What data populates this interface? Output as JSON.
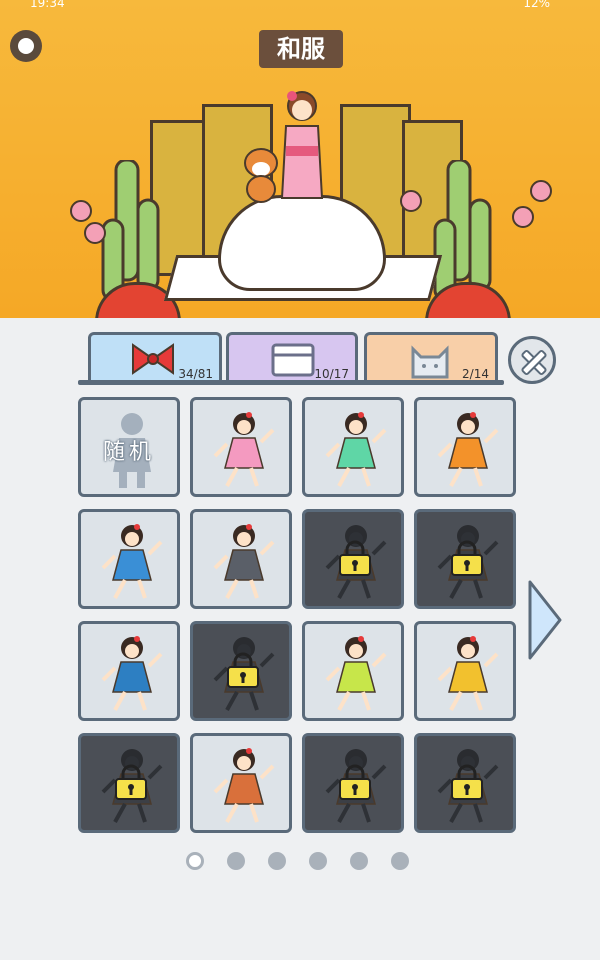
{
  "status_bar": {
    "time": "19:34",
    "battery": "12%"
  },
  "header": {
    "title": "和服"
  },
  "tabs": [
    {
      "name": "bow",
      "count": "34/81",
      "color": "#bfe0f7"
    },
    {
      "name": "box",
      "count": "10/17",
      "color": "#d7c6f0"
    },
    {
      "name": "cat",
      "count": "2/14",
      "color": "#f8cfa8"
    }
  ],
  "grid": {
    "random_label": "随机",
    "items": [
      {
        "type": "random",
        "locked": false
      },
      {
        "dress": "#f49ac0",
        "locked": false
      },
      {
        "dress": "#5fd6a6",
        "locked": false
      },
      {
        "dress": "#f3922a",
        "locked": false
      },
      {
        "dress": "#3a8fd6",
        "locked": false
      },
      {
        "dress": "#5a5f68",
        "locked": false
      },
      {
        "dress": "#3c3f45",
        "locked": true
      },
      {
        "dress": "#3c3f45",
        "locked": true
      },
      {
        "dress": "#2d7fc2",
        "locked": false
      },
      {
        "dress": "#3c3f45",
        "locked": true
      },
      {
        "dress": "#c7e64a",
        "locked": false
      },
      {
        "dress": "#f2c12e",
        "locked": false
      },
      {
        "dress": "#3c3f45",
        "locked": true
      },
      {
        "dress": "#d9703b",
        "locked": false
      },
      {
        "dress": "#3c3f45",
        "locked": true
      },
      {
        "dress": "#3c3f45",
        "locked": true
      }
    ]
  },
  "pagination": {
    "total": 6,
    "current": 0
  },
  "colors": {
    "accent_bow": "#e63a3a",
    "lock": "#f5e04a"
  }
}
